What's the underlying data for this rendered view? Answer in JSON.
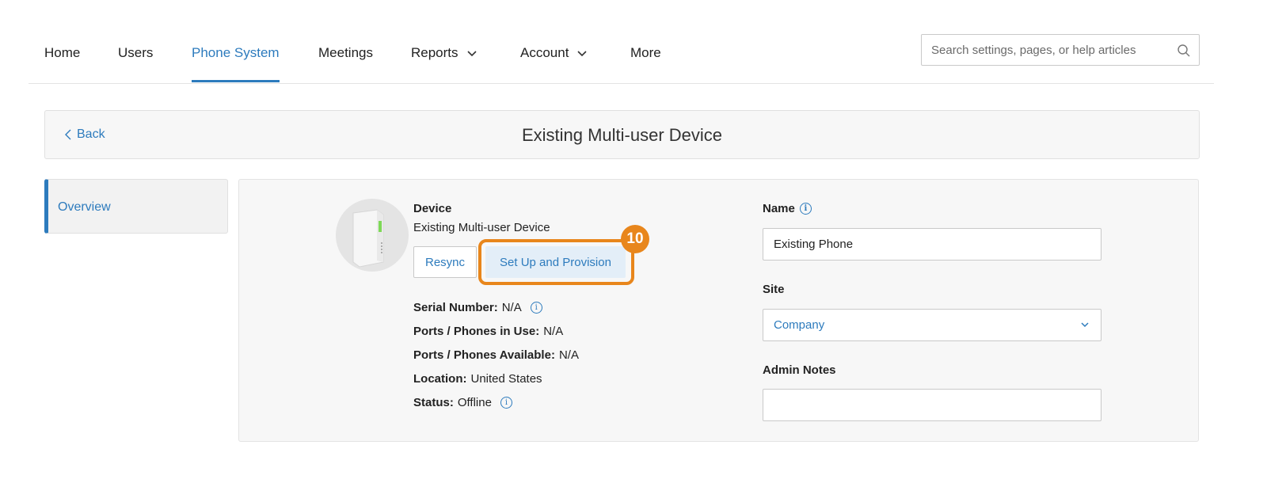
{
  "nav": {
    "items": [
      {
        "label": "Home"
      },
      {
        "label": "Users"
      },
      {
        "label": "Phone System"
      },
      {
        "label": "Meetings"
      },
      {
        "label": "Reports"
      },
      {
        "label": "Account"
      },
      {
        "label": "More"
      }
    ],
    "active": "Phone System",
    "search_placeholder": "Search settings, pages, or help articles"
  },
  "header": {
    "back_label": "Back",
    "title": "Existing Multi-user Device"
  },
  "sidebar": {
    "items": [
      {
        "label": "Overview",
        "active": true
      }
    ]
  },
  "device": {
    "label": "Device",
    "name": "Existing Multi-user Device",
    "resync_label": "Resync",
    "provision_label": "Set Up and Provision",
    "step_badge": "10",
    "serial_label": "Serial Number:",
    "serial_value": "N/A",
    "ports_in_use_label": "Ports / Phones in Use:",
    "ports_in_use_value": "N/A",
    "ports_available_label": "Ports / Phones Available:",
    "ports_available_value": "N/A",
    "location_label": "Location:",
    "location_value": "United States",
    "status_label": "Status:",
    "status_value": "Offline"
  },
  "form": {
    "name_label": "Name",
    "name_value": "Existing Phone",
    "site_label": "Site",
    "site_value": "Company",
    "notes_label": "Admin Notes",
    "notes_value": ""
  },
  "colors": {
    "accent": "#2d7bbd",
    "highlight": "#e8861c"
  }
}
